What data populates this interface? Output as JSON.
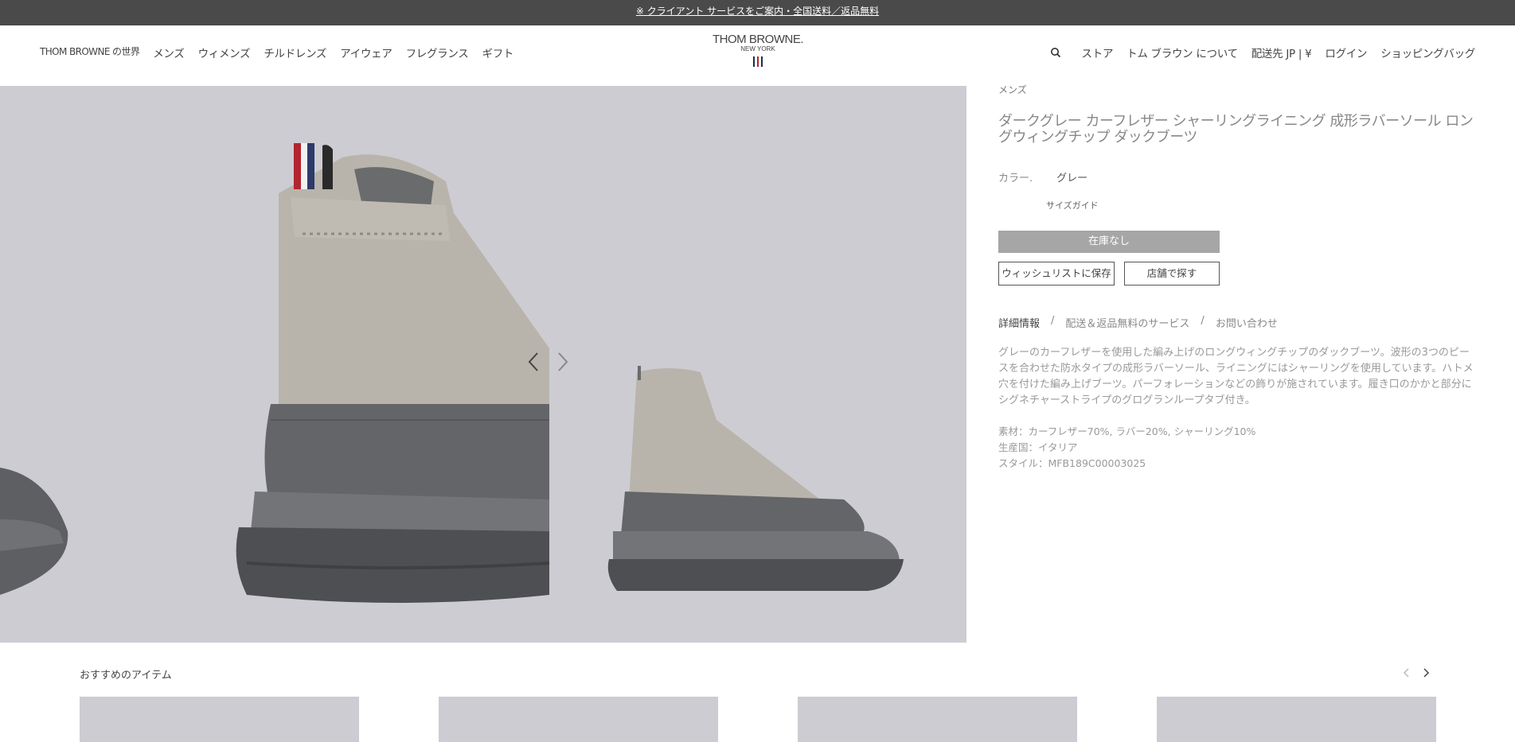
{
  "announcement": "※ クライアント サービスをご案内・全国送料／返品無料",
  "nav": {
    "left": [
      "THOM BROWNE の世界",
      "メンズ",
      "ウィメンズ",
      "チルドレンズ",
      "アイウェア",
      "フレグランス",
      "ギフト"
    ],
    "right": [
      "ストア",
      "トム ブラウン について",
      "配送先 JP | ¥",
      "ログイン",
      "ショッピングバッグ"
    ]
  },
  "logo": {
    "brand": "THOM BROWNE.",
    "sub": "NEW YORK"
  },
  "product": {
    "breadcrumb": "メンズ",
    "title": "ダークグレー カーフレザー シャーリングライニング 成形ラバーソール ロングウィングチップ ダックブーツ",
    "color_label": "カラー.",
    "color_value": "グレー",
    "size_guide": "サイズガイド",
    "out_of_stock": "在庫なし",
    "wishlist": "ウィッシュリストに保存",
    "find_store": "店舗で探す",
    "tabs": [
      "詳細情報",
      "配送＆返品無料のサービス",
      "お問い合わせ"
    ],
    "tab_separator": "/",
    "description": "グレーのカーフレザーを使用した編み上げのロングウィングチップのダックブーツ。波形の3つのピースを合わせた防水タイプの成形ラバーソール、ライニングにはシャーリングを使用しています。ハトメ穴を付けた編み上げブーツ。パーフォレーションなどの飾りが施されています。履き口のかかと部分にシグネチャーストライプのグログランループタブ付き。",
    "material": "素材：カーフレザー70%, ラバー20%, シャーリング10%",
    "origin": "生産国：イタリア",
    "style": "スタイル：MFB189C00003025"
  },
  "recommended": {
    "title": "おすすめのアイテム"
  },
  "colors": {
    "topbar": "#4a4a4a",
    "hero_bg": "#cdccd2",
    "button_disabled": "#a6a6a6"
  },
  "icons": [
    "search-icon",
    "chevron-left-icon",
    "chevron-right-icon"
  ]
}
